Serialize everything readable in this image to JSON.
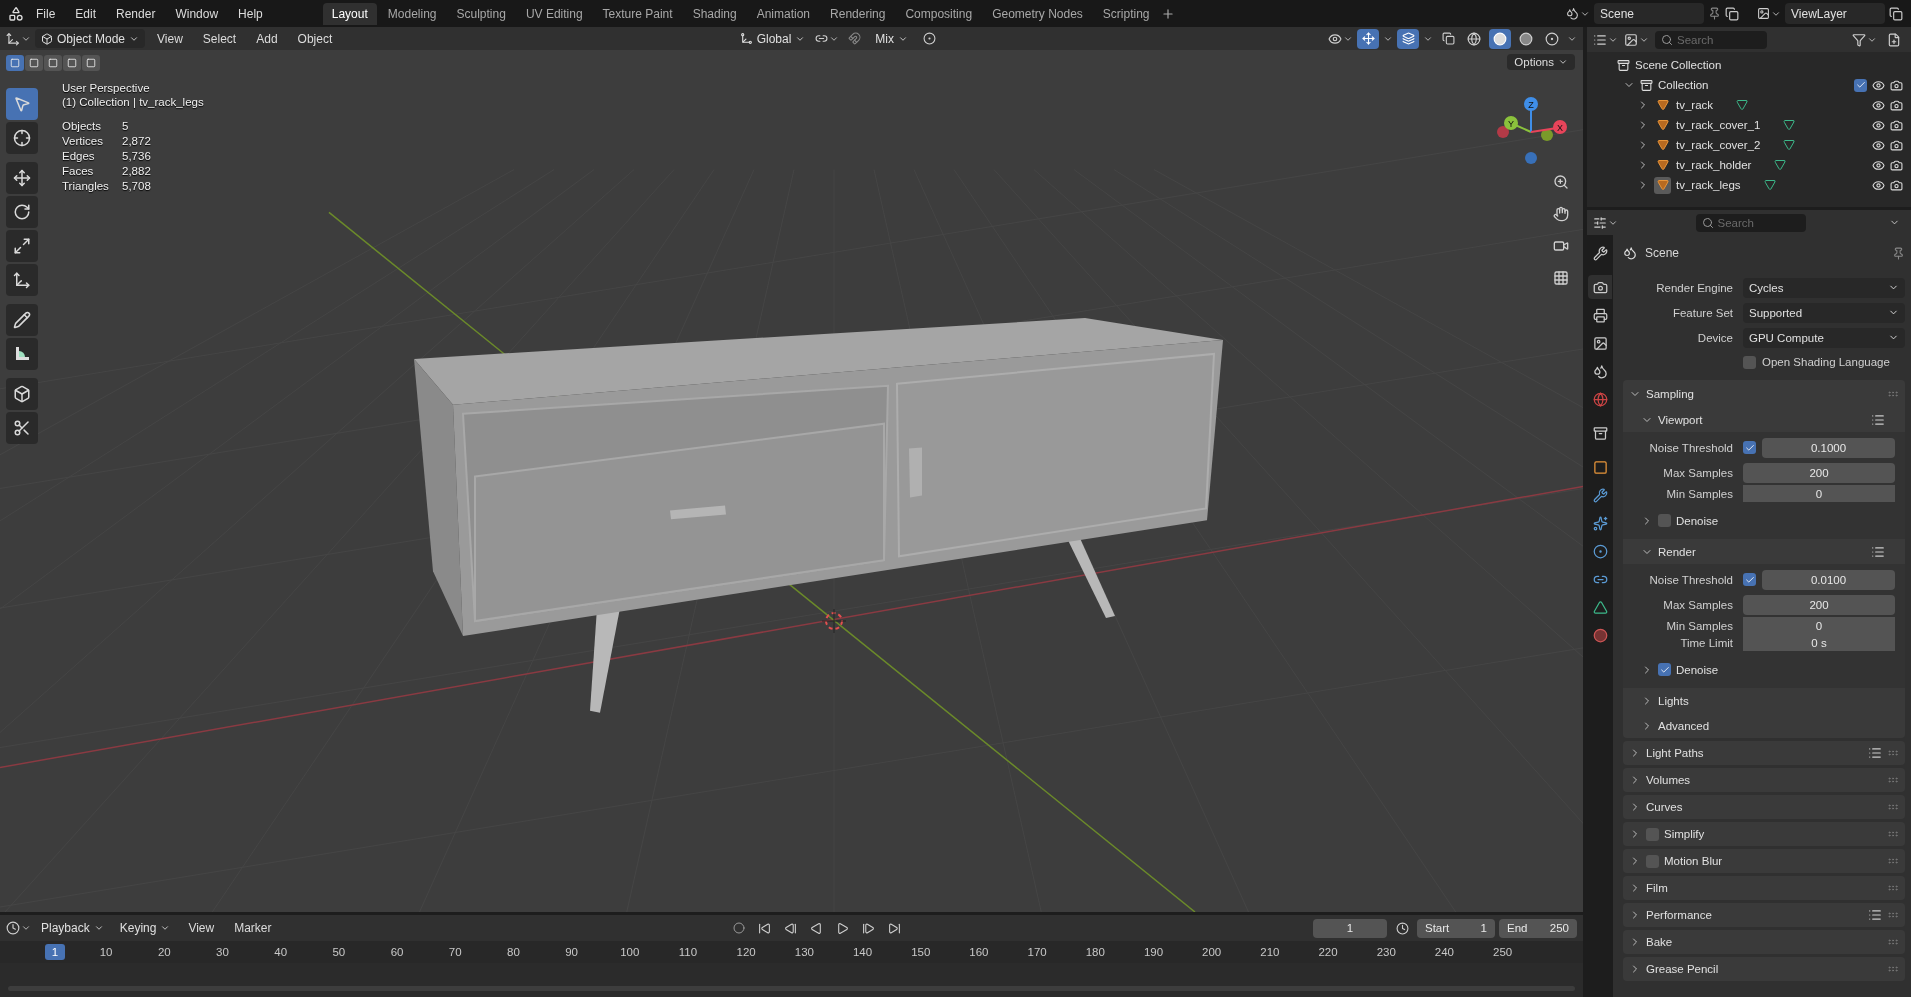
{
  "topbar": {
    "menus": [
      "File",
      "Edit",
      "Render",
      "Window",
      "Help"
    ],
    "workspaces": [
      {
        "label": "Layout",
        "selected": true
      },
      {
        "label": "Modeling",
        "selected": false
      },
      {
        "label": "Sculpting",
        "selected": false
      },
      {
        "label": "UV Editing",
        "selected": false
      },
      {
        "label": "Texture Paint",
        "selected": false
      },
      {
        "label": "Shading",
        "selected": false
      },
      {
        "label": "Animation",
        "selected": false
      },
      {
        "label": "Rendering",
        "selected": false
      },
      {
        "label": "Compositing",
        "selected": false
      },
      {
        "label": "Geometry Nodes",
        "selected": false
      },
      {
        "label": "Scripting",
        "selected": false
      }
    ],
    "scene": "Scene",
    "view_layer": "ViewLayer"
  },
  "viewport": {
    "header": {
      "mode": "Object Mode",
      "menus": [
        "View",
        "Select",
        "Add",
        "Object"
      ],
      "orientation": "Global",
      "snap": "Mix"
    },
    "shading": [
      {
        "kind": "wireframe",
        "selected": false
      },
      {
        "kind": "solid",
        "selected": true
      },
      {
        "kind": "material",
        "selected": false
      },
      {
        "kind": "rendered",
        "selected": false
      }
    ],
    "select_modes": [
      {
        "selected": true
      },
      {
        "selected": false
      },
      {
        "selected": false
      },
      {
        "selected": false
      },
      {
        "selected": false
      }
    ],
    "options": "Options",
    "tools": [
      {
        "kind": "select",
        "selected": true
      },
      {
        "kind": "cursor",
        "selected": false
      },
      {
        "kind": "move",
        "selected": false
      },
      {
        "kind": "rotate",
        "selected": false
      },
      {
        "kind": "scale",
        "selected": false
      },
      {
        "kind": "transform",
        "selected": false
      },
      {
        "kind": "annotate",
        "selected": false
      },
      {
        "kind": "measure",
        "selected": false
      },
      {
        "kind": "add-cube",
        "selected": false
      },
      {
        "kind": "cut",
        "selected": false
      }
    ],
    "info": {
      "view": "User Perspective",
      "context": "(1) Collection | tv_rack_legs",
      "stats": [
        {
          "label": "Objects",
          "value": "5"
        },
        {
          "label": "Vertices",
          "value": "2,872"
        },
        {
          "label": "Edges",
          "value": "5,736"
        },
        {
          "label": "Faces",
          "value": "2,882"
        },
        {
          "label": "Triangles",
          "value": "5,708"
        }
      ]
    },
    "gizmo": {
      "x": "X",
      "y": "Y",
      "z": "Z"
    }
  },
  "outliner": {
    "search": {
      "placeholder": "Search"
    },
    "root": "Scene Collection",
    "collection": {
      "name": "Collection",
      "expanded": true,
      "checked": true,
      "children": [
        {
          "name": "tv_rack",
          "expanded": false,
          "selected": false
        },
        {
          "name": "tv_rack_cover_1",
          "expanded": false,
          "selected": false
        },
        {
          "name": "tv_rack_cover_2",
          "expanded": false,
          "selected": false
        },
        {
          "name": "tv_rack_holder",
          "expanded": false,
          "selected": false
        },
        {
          "name": "tv_rack_legs",
          "expanded": false,
          "selected": true
        }
      ]
    }
  },
  "properties": {
    "search": {
      "placeholder": "Search"
    },
    "tabs": [
      {
        "kind": "tool",
        "selected": false
      },
      {
        "kind": "render",
        "selected": true
      },
      {
        "kind": "output",
        "selected": false
      },
      {
        "kind": "view-layer",
        "selected": false
      },
      {
        "kind": "scene",
        "selected": false
      },
      {
        "kind": "world",
        "selected": false
      },
      {
        "kind": "collection",
        "selected": false
      },
      {
        "kind": "object",
        "selected": false
      },
      {
        "kind": "modifiers",
        "selected": false
      },
      {
        "kind": "particles",
        "selected": false
      },
      {
        "kind": "physics",
        "selected": false
      },
      {
        "kind": "constraints",
        "selected": false
      },
      {
        "kind": "data",
        "selected": false
      },
      {
        "kind": "material",
        "selected": false
      }
    ],
    "context": "Scene",
    "fields": [
      {
        "label": "Render Engine",
        "value": "Cycles"
      },
      {
        "label": "Feature Set",
        "value": "Supported"
      },
      {
        "label": "Device",
        "value": "GPU Compute"
      }
    ],
    "osl": {
      "label": "Open Shading Language",
      "checked": false
    },
    "sampling": {
      "label": "Sampling",
      "expanded": true,
      "groups": [
        {
          "label": "Viewport",
          "expanded": true,
          "rows": [
            {
              "kind": "check-number",
              "label": "Noise Threshold",
              "checked": true,
              "value": "0.1000"
            },
            {
              "kind": "number",
              "label": "Max Samples",
              "value": "200"
            },
            {
              "kind": "number",
              "label": "Min Samples",
              "value": "0"
            }
          ],
          "denoise": {
            "label": "Denoise",
            "checked": false,
            "expanded": false
          }
        },
        {
          "label": "Render",
          "expanded": true,
          "rows": [
            {
              "kind": "check-number",
              "label": "Noise Threshold",
              "checked": true,
              "value": "0.0100"
            },
            {
              "kind": "number",
              "label": "Max Samples",
              "value": "200"
            },
            {
              "kind": "number",
              "label": "Min Samples",
              "value": "0"
            },
            {
              "kind": "number",
              "label": "Time Limit",
              "value": "0 s"
            }
          ],
          "denoise": {
            "label": "Denoise",
            "checked": true,
            "expanded": false
          }
        }
      ],
      "subpanels": [
        {
          "label": "Lights",
          "expanded": false
        },
        {
          "label": "Advanced",
          "expanded": false
        }
      ]
    },
    "panels": [
      {
        "kind": "plain",
        "label": "Light Paths",
        "presets": true,
        "expanded": false
      },
      {
        "kind": "plain",
        "label": "Volumes",
        "presets": false,
        "expanded": false
      },
      {
        "kind": "plain",
        "label": "Curves",
        "presets": false,
        "expanded": false
      },
      {
        "kind": "toggle",
        "label": "Simplify",
        "checked": false,
        "presets": false,
        "expanded": false
      },
      {
        "kind": "toggle",
        "label": "Motion Blur",
        "checked": false,
        "presets": false,
        "expanded": false
      },
      {
        "kind": "plain",
        "label": "Film",
        "presets": false,
        "expanded": false
      },
      {
        "kind": "plain",
        "label": "Performance",
        "presets": true,
        "expanded": false
      },
      {
        "kind": "plain",
        "label": "Bake",
        "presets": false,
        "expanded": false
      },
      {
        "kind": "plain",
        "label": "Grease Pencil",
        "presets": false,
        "expanded": false
      }
    ]
  },
  "timeline": {
    "menus": [
      "Playback",
      "Keying",
      "View",
      "Marker"
    ],
    "current_frame": "1",
    "start_label": "Start",
    "start": "1",
    "end_label": "End",
    "end": "250",
    "marker": "1",
    "ticks": [
      "10",
      "20",
      "30",
      "40",
      "50",
      "60",
      "70",
      "80",
      "90",
      "100",
      "110",
      "120",
      "130",
      "140",
      "150",
      "160",
      "170",
      "180",
      "190",
      "200",
      "210",
      "220",
      "230",
      "240",
      "250"
    ]
  }
}
